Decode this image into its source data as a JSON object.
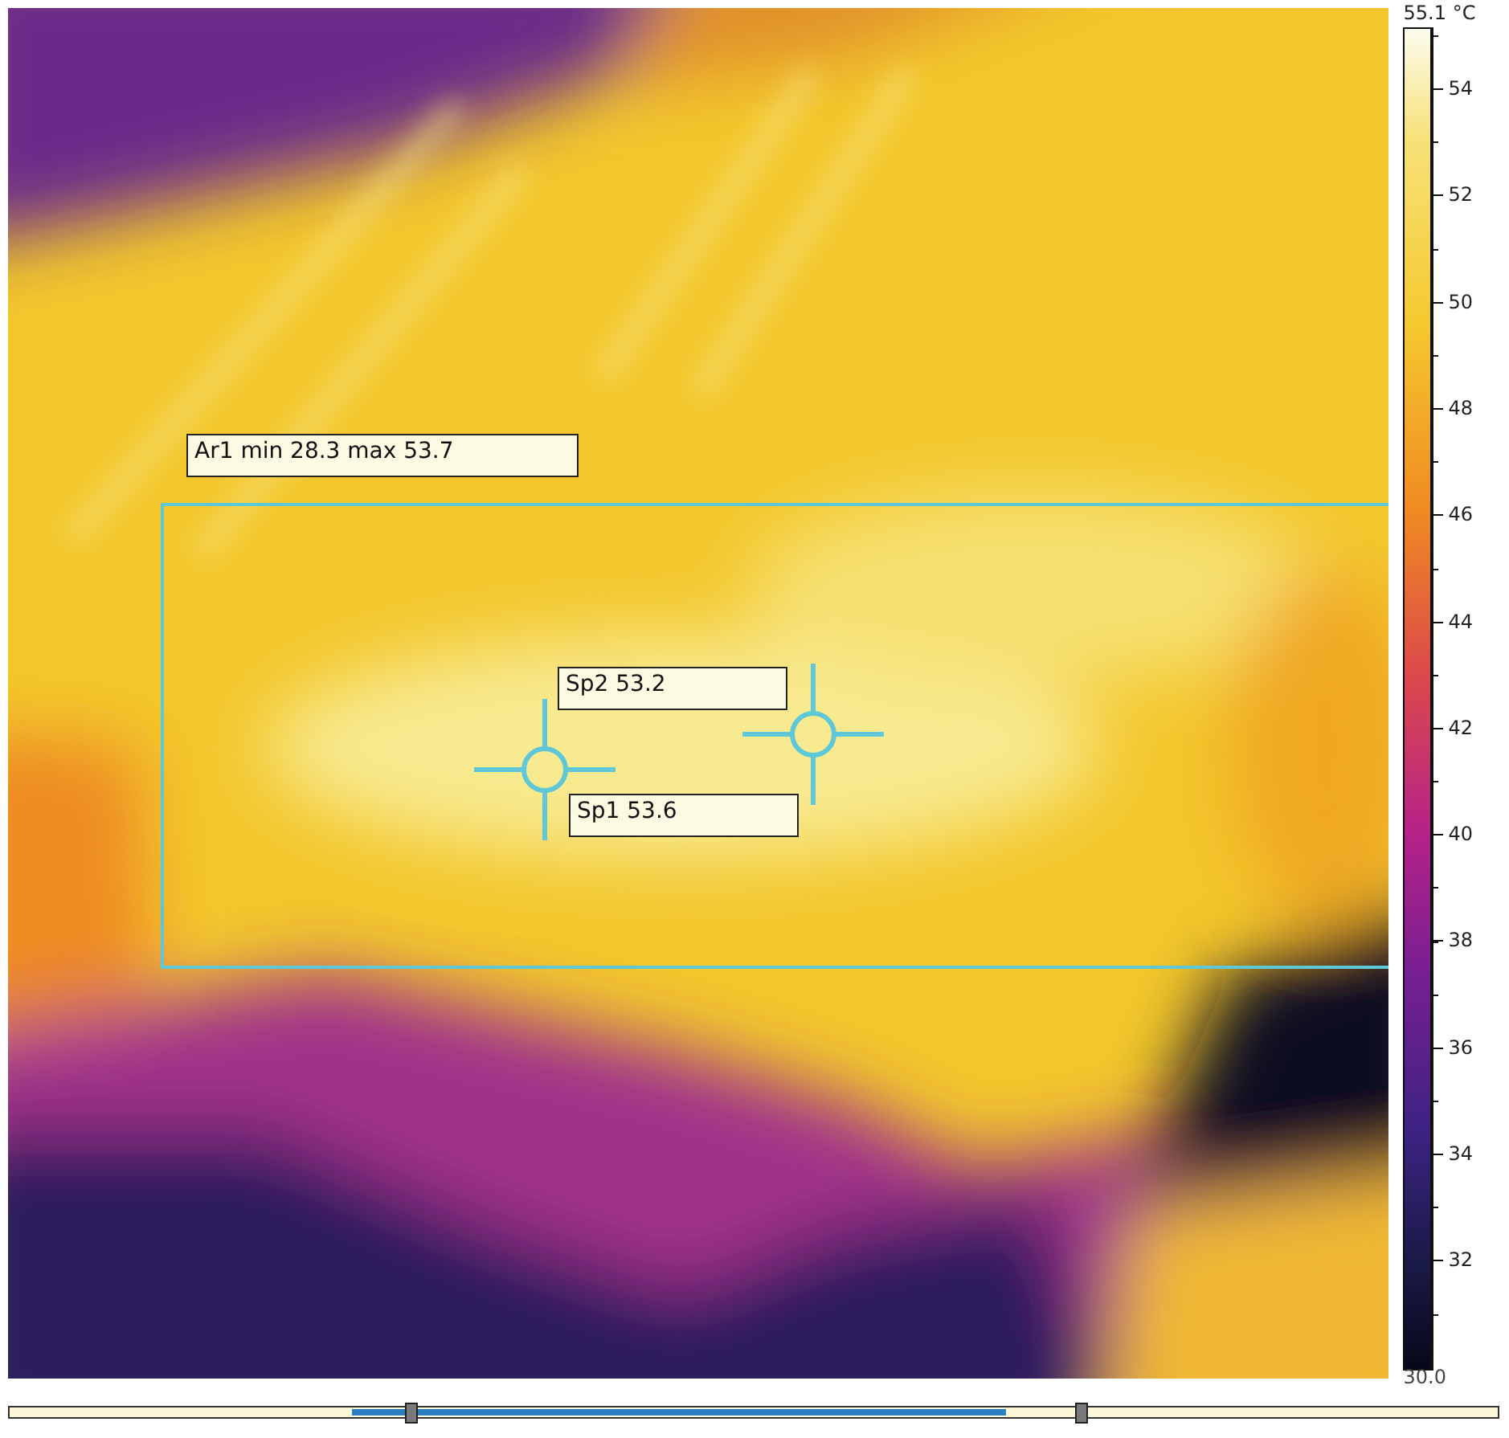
{
  "areas": [
    {
      "label": "Ar1 min 28.3 max 53.7"
    }
  ],
  "spots": [
    {
      "label": "Sp2 53.2"
    },
    {
      "label": "Sp1 53.6"
    }
  ],
  "color_scale": {
    "max_label": "55.1 °C",
    "ticks": [
      "54",
      "52",
      "50",
      "48",
      "46",
      "44",
      "42",
      "40",
      "38",
      "36",
      "34",
      "32"
    ],
    "min_label": "30.0"
  },
  "range_slider": {
    "handles": [
      {
        "level": 0.27
      },
      {
        "level": 0.72
      }
    ]
  }
}
